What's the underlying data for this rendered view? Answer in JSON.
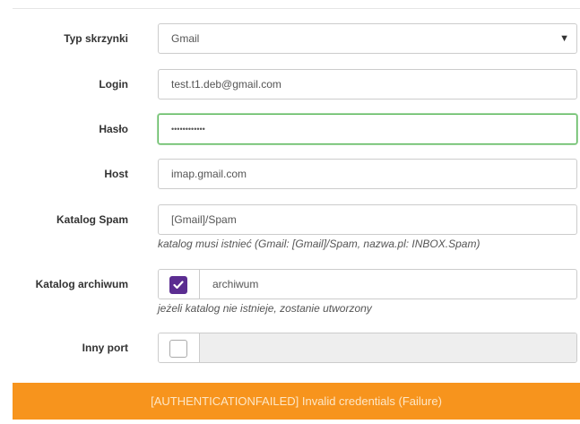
{
  "form": {
    "mailbox_type": {
      "label": "Typ skrzynki",
      "value": "Gmail"
    },
    "login": {
      "label": "Login",
      "value": "test.t1.deb@gmail.com"
    },
    "password": {
      "label": "Hasło",
      "value": "••••••••••••"
    },
    "host": {
      "label": "Host",
      "value": "imap.gmail.com"
    },
    "spam_folder": {
      "label": "Katalog Spam",
      "value": "[Gmail]/Spam",
      "help": "katalog musi istnieć (Gmail: [Gmail]/Spam, nazwa.pl: INBOX.Spam)"
    },
    "archive_folder": {
      "label": "Katalog archiwum",
      "checked": true,
      "value": "archiwum",
      "help": "jeżeli katalog nie istnieje, zostanie utworzony"
    },
    "other_port": {
      "label": "Inny port",
      "checked": false,
      "value": ""
    }
  },
  "alert": {
    "message": "[AUTHENTICATIONFAILED] Invalid credentials (Failure)",
    "color": "#f7941d"
  },
  "colors": {
    "checkbox_checked": "#5b2d91",
    "focus_border": "#5cb85c"
  }
}
